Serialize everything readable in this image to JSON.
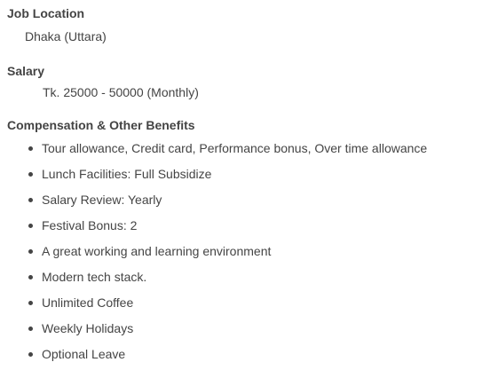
{
  "job_location": {
    "title": "Job Location",
    "value": "Dhaka (Uttara)"
  },
  "salary": {
    "title": "Salary",
    "value": "Tk. 25000 - 50000 (Monthly)"
  },
  "benefits": {
    "title": "Compensation & Other Benefits",
    "items": [
      "Tour allowance, Credit card, Performance bonus, Over time allowance",
      "Lunch Facilities: Full Subsidize",
      "Salary Review: Yearly",
      "Festival Bonus: 2",
      "A great working and learning environment",
      "Modern tech stack.",
      "Unlimited Coffee",
      "Weekly Holidays",
      "Optional Leave"
    ]
  }
}
